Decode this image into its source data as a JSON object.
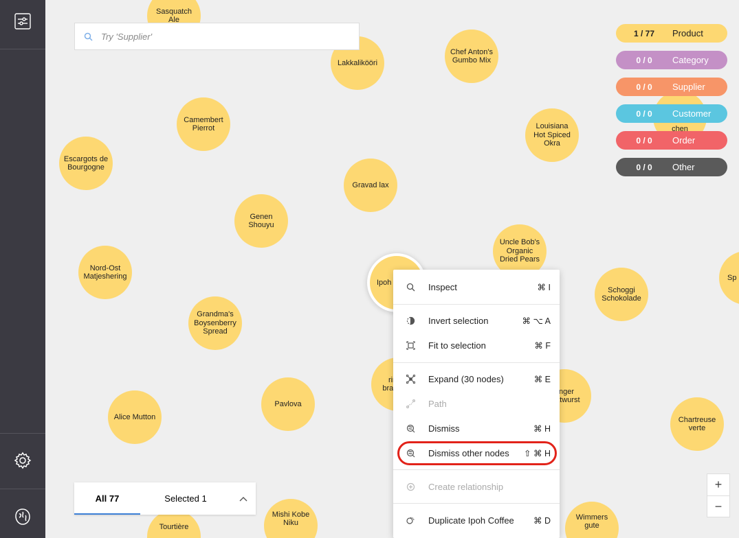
{
  "search": {
    "placeholder": "Try 'Supplier'"
  },
  "legend": [
    {
      "count": "1 / 77",
      "label": "Product",
      "color": "#fdd872",
      "text_color": "#222222"
    },
    {
      "count": "0 / 0",
      "label": "Category",
      "color": "#c490c6",
      "text_color": "#ffffff"
    },
    {
      "count": "0 / 0",
      "label": "Supplier",
      "color": "#f79568",
      "text_color": "#ffffff"
    },
    {
      "count": "0 / 0",
      "label": "Customer",
      "color": "#5bc6e0",
      "text_color": "#ffffff"
    },
    {
      "count": "0 / 0",
      "label": "Order",
      "color": "#f16468",
      "text_color": "#ffffff"
    },
    {
      "count": "0 / 0",
      "label": "Other",
      "color": "#5a5a5a",
      "text_color": "#ffffff"
    }
  ],
  "nodes": [
    "Sasquatch Ale",
    "Lakkalikööri",
    "Chef Anton's Gumbo Mix",
    "Camembert Pierrot",
    "Louisiana Hot Spiced Okra",
    "chen",
    "Escargots de Bourgogne",
    "Gravad lax",
    "Genen Shouyu",
    "Uncle Bob's Organic Dried Pears",
    "Nord-Ost Matjeshering",
    "Ipoh",
    "Schoggi Schokolade",
    "Sp",
    "Grandma's Boysenberry Spread",
    "Pavlova",
    "ringer bratwurst",
    "Alice Mutton",
    "Chartreuse verte",
    "Mishi Kobe Niku",
    "Tourtière",
    "Wimmers gute"
  ],
  "tabs": {
    "all": "All 77",
    "selected": "Selected 1"
  },
  "zoom": {
    "in": "+",
    "out": "−"
  },
  "menu": {
    "inspect": {
      "label": "Inspect",
      "shortcut": "⌘ I"
    },
    "invert": {
      "label": "Invert selection",
      "shortcut": "⌘ ⌥ A"
    },
    "fit": {
      "label": "Fit to selection",
      "shortcut": "⌘ F"
    },
    "expand": {
      "label": "Expand (30 nodes)",
      "shortcut": "⌘ E"
    },
    "path": {
      "label": "Path"
    },
    "dismiss": {
      "label": "Dismiss",
      "shortcut": "⌘ H"
    },
    "dismiss_others": {
      "label": "Dismiss other nodes",
      "shortcut": "⇧ ⌘ H"
    },
    "create_rel": {
      "label": "Create relationship"
    },
    "duplicate": {
      "label": "Duplicate Ipoh Coffee",
      "shortcut": "⌘ D"
    }
  },
  "colors": {
    "rail": "#3b3a42",
    "canvas": "#efefef",
    "node": "#fdd872",
    "highlight": "#e2231a",
    "tab_accent": "#3c7fd6"
  }
}
